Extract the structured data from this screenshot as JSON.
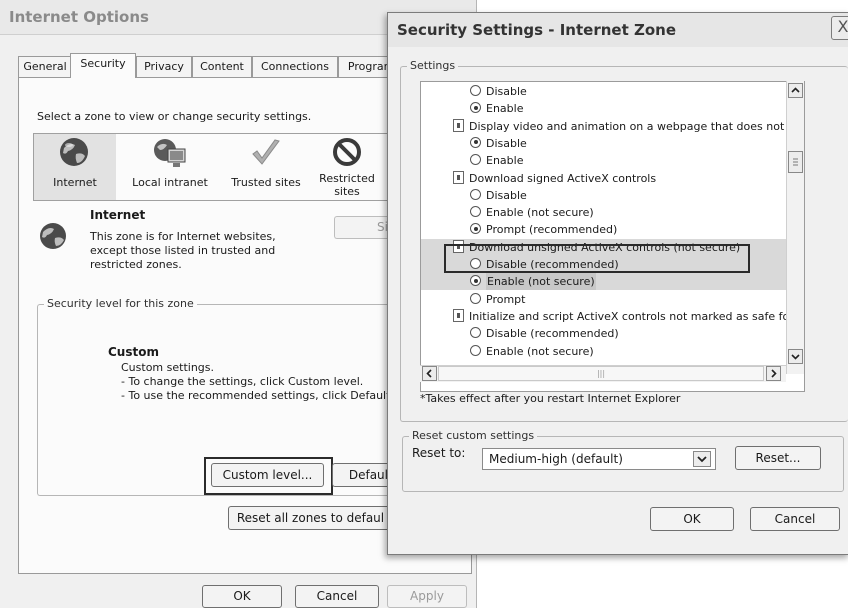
{
  "internet_options": {
    "title": "Internet Options",
    "tabs": [
      "General",
      "Security",
      "Privacy",
      "Content",
      "Connections",
      "Programs"
    ],
    "select_zone_text": "Select a zone to view or change security settings.",
    "zones": [
      {
        "label": "Internet",
        "icon": "globe-icon"
      },
      {
        "label": "Local intranet",
        "icon": "intranet-icon"
      },
      {
        "label": "Trusted sites",
        "icon": "checkmark-icon"
      },
      {
        "label": "Restricted sites",
        "icon": "restricted-icon"
      }
    ],
    "zone_info": {
      "heading": "Internet",
      "description": "This zone is for Internet websites, except those listed in trusted and restricted zones.",
      "sites_button_partial": "Si"
    },
    "security_level": {
      "legend": "Security level for this zone",
      "heading": "Custom",
      "line1": "Custom settings.",
      "line2": "- To change the settings, click Custom level.",
      "line3": "- To use the recommended settings, click Default"
    },
    "custom_level_label": "Custom level...",
    "default_level_label": "Defaul",
    "reset_all_zones_label": "Reset all zones to defaul",
    "ok_label": "OK",
    "cancel_label": "Cancel",
    "apply_label": "Apply"
  },
  "security_settings": {
    "title": "Security Settings - Internet Zone",
    "close_glyph": "X",
    "settings_legend": "Settings",
    "list_items": [
      {
        "kind": "radio",
        "label": "Disable",
        "checked": false,
        "indent": 1
      },
      {
        "kind": "radio",
        "label": "Enable",
        "checked": true,
        "indent": 1
      },
      {
        "kind": "header",
        "label": "Display video and animation on a webpage that does not use"
      },
      {
        "kind": "radio",
        "label": "Disable",
        "checked": true,
        "indent": 1
      },
      {
        "kind": "radio",
        "label": "Enable",
        "checked": false,
        "indent": 1
      },
      {
        "kind": "header",
        "label": "Download signed ActiveX controls"
      },
      {
        "kind": "radio",
        "label": "Disable",
        "checked": false,
        "indent": 1
      },
      {
        "kind": "radio",
        "label": "Enable (not secure)",
        "checked": false,
        "indent": 1
      },
      {
        "kind": "radio",
        "label": "Prompt (recommended)",
        "checked": true,
        "indent": 1
      },
      {
        "kind": "header",
        "label": "Download unsigned ActiveX controls (not secure)",
        "selected": true,
        "boxed": true
      },
      {
        "kind": "radio",
        "label": "Disable (recommended)",
        "checked": false,
        "indent": 1,
        "selected": true
      },
      {
        "kind": "radio",
        "label": "Enable (not secure)",
        "checked": true,
        "indent": 1,
        "selected": true,
        "focused": true
      },
      {
        "kind": "radio",
        "label": "Prompt",
        "checked": false,
        "indent": 1
      },
      {
        "kind": "header",
        "label": "Initialize and script ActiveX controls not marked as safe for s"
      },
      {
        "kind": "radio",
        "label": "Disable (recommended)",
        "checked": false,
        "indent": 1
      },
      {
        "kind": "radio",
        "label": "Enable (not secure)",
        "checked": false,
        "indent": 1
      }
    ],
    "footnote": "*Takes effect after you restart Internet Explorer",
    "reset_legend": "Reset custom settings",
    "reset_to_label": "Reset to:",
    "reset_to_value": "Medium-high (default)",
    "reset_button_label": "Reset...",
    "ok_label": "OK",
    "cancel_label": "Cancel"
  },
  "colors": {
    "dialog_bg": "#f0f0f0",
    "selection_bg": "#d9d9d9",
    "highlight_box": "#2b2b2b"
  }
}
